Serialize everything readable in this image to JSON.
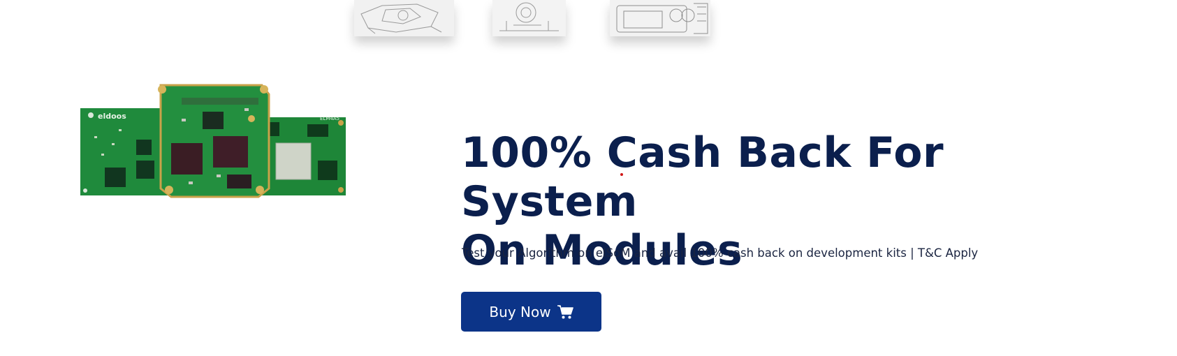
{
  "thumbnails": [
    {
      "alt": "technical-drawing-1"
    },
    {
      "alt": "technical-drawing-2"
    },
    {
      "alt": "technical-drawing-3"
    }
  ],
  "product_image": {
    "brand_label": "eldoos",
    "chip_label": "ELM4A5"
  },
  "hero": {
    "headline_line1": "100% Cash Back For System",
    "headline_line2": "On Modules",
    "subtext": "Test your Algorithm on elSoM and avail 100% cash back on development kits | T&C Apply",
    "button_label": "Buy Now"
  },
  "colors": {
    "headline": "#0b1f4d",
    "button_bg": "#0c3488",
    "pcb_green": "#1f8a3c"
  },
  "icons": {
    "button_icon": "shopping-cart-icon"
  }
}
